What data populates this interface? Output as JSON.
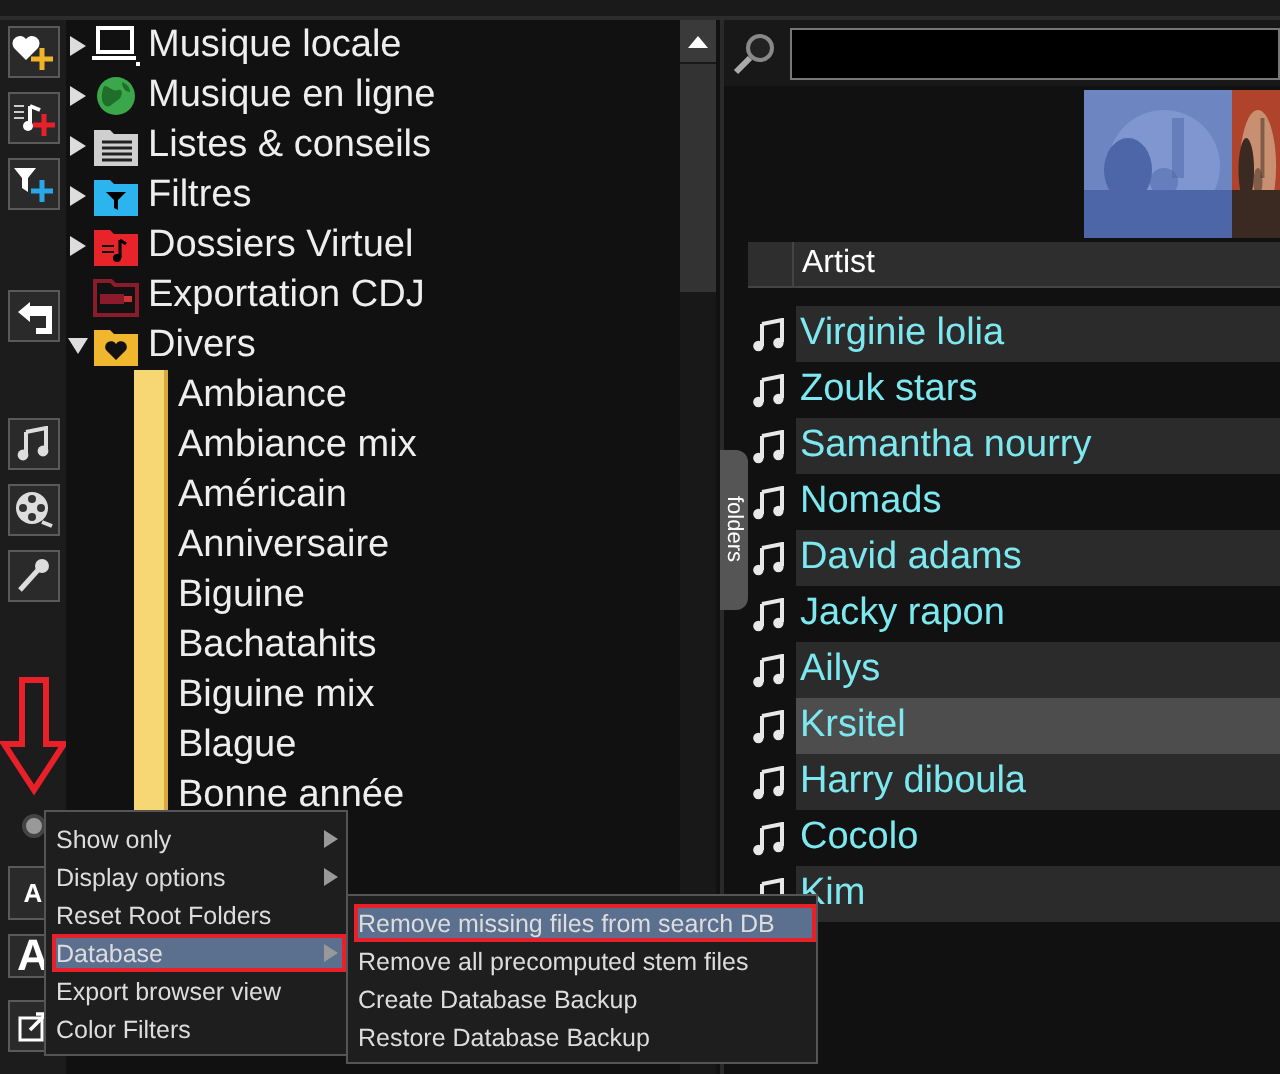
{
  "toolbar": {
    "font_buttons": [
      {
        "label": "A"
      },
      {
        "label": "A"
      }
    ]
  },
  "tree": {
    "items": [
      {
        "label": "Musique locale",
        "expanded": false
      },
      {
        "label": "Musique en ligne",
        "expanded": false
      },
      {
        "label": "Listes & conseils",
        "expanded": false
      },
      {
        "label": "Filtres",
        "expanded": false
      },
      {
        "label": "Dossiers Virtuel",
        "expanded": false
      },
      {
        "label": "Exportation CDJ"
      },
      {
        "label": "Divers",
        "expanded": true,
        "children": [
          {
            "label": "Ambiance"
          },
          {
            "label": "Ambiance mix"
          },
          {
            "label": "Américain"
          },
          {
            "label": "Anniversaire"
          },
          {
            "label": "Biguine"
          },
          {
            "label": "Bachatahits"
          },
          {
            "label": "Biguine mix"
          },
          {
            "label": "Blague"
          },
          {
            "label": "Bonne année"
          }
        ]
      }
    ]
  },
  "browser": {
    "side_tab": "folders",
    "columns": [
      {
        "label": "Artist"
      }
    ],
    "rows": [
      {
        "artist": "Virginie lolia",
        "selected": false
      },
      {
        "artist": "Zouk stars",
        "selected": false
      },
      {
        "artist": "Samantha nourry",
        "selected": false
      },
      {
        "artist": "Nomads",
        "selected": false
      },
      {
        "artist": "David adams",
        "selected": false
      },
      {
        "artist": "Jacky rapon",
        "selected": false
      },
      {
        "artist": "Ailys",
        "selected": false
      },
      {
        "artist": "Krsitel",
        "selected": true
      },
      {
        "artist": "Harry diboula",
        "selected": false
      },
      {
        "artist": "Cocolo",
        "selected": false
      },
      {
        "artist": "Kim",
        "selected": false
      }
    ]
  },
  "context_menu": {
    "items": [
      {
        "label": "Show only",
        "submenu": true,
        "selected": false,
        "highlighted": false
      },
      {
        "label": "Display options",
        "submenu": true,
        "selected": false,
        "highlighted": false
      },
      {
        "label": "Reset Root Folders",
        "submenu": false,
        "selected": false,
        "highlighted": false
      },
      {
        "label": "Database",
        "submenu": true,
        "selected": true,
        "highlighted": true
      },
      {
        "label": "Export browser view",
        "submenu": false,
        "selected": false,
        "highlighted": false
      },
      {
        "label": "Color Filters",
        "submenu": false,
        "selected": false,
        "highlighted": false
      }
    ],
    "submenu": {
      "items": [
        {
          "label": "Remove missing files from search DB",
          "selected": true,
          "highlighted": true
        },
        {
          "label": "Remove all precomputed stem files",
          "selected": false,
          "highlighted": false
        },
        {
          "label": "Create Database Backup",
          "selected": false,
          "highlighted": false
        },
        {
          "label": "Restore Database Backup",
          "selected": false,
          "highlighted": false
        }
      ]
    }
  }
}
